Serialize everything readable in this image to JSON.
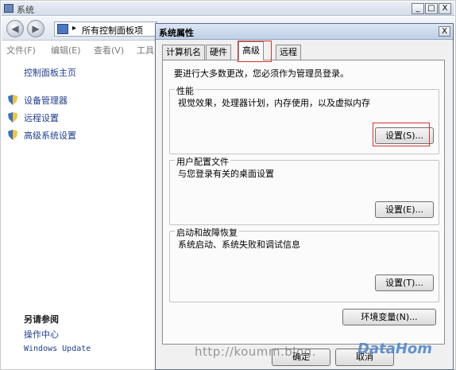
{
  "bg_window": {
    "title": "系统",
    "controls": {
      "minimize": "_",
      "maximize": "□",
      "close": "X"
    },
    "address": {
      "path": "所有控制面板项",
      "separator": "▾",
      "overflow": "▸"
    },
    "menu": [
      "文件(F)",
      "编辑(E)",
      "查看(V)",
      "工具"
    ],
    "sidebar": {
      "home": "控制面板主页",
      "links": [
        "设备管理器",
        "远程设置",
        "高级系统设置"
      ],
      "see_also_header": "另请参阅",
      "see_also": [
        "操作中心",
        "Windows Update"
      ]
    }
  },
  "dialog": {
    "title": "系统属性",
    "close": "X",
    "tabs": [
      "计算机名",
      "硬件",
      "高级",
      "远程"
    ],
    "active_tab": "高级",
    "notice": "要进行大多数更改，您必须作为管理员登录。",
    "groups": [
      {
        "label": "性能",
        "desc": "视觉效果，处理器计划，内存使用，以及虚拟内存",
        "button": "设置(S)..."
      },
      {
        "label": "用户配置文件",
        "desc": "与您登录有关的桌面设置",
        "button": "设置(E)..."
      },
      {
        "label": "启动和故障恢复",
        "desc": "系统启动、系统失败和调试信息",
        "button": "设置(T)..."
      }
    ],
    "env_button": "环境变量(N)...",
    "bottom_buttons": [
      "确定",
      "取消"
    ]
  },
  "watermark": {
    "text": "http://koumm.blog.",
    "logo": "DataHom"
  },
  "colors": {
    "highlight": "#d9332c",
    "link": "#1f3d8f",
    "dialog_bg": "#f0f0f0"
  }
}
